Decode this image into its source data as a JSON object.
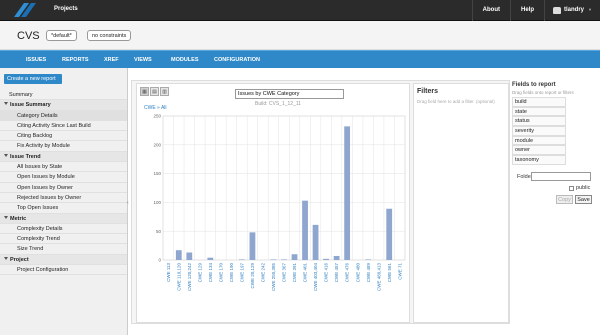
{
  "topbar": {
    "projects_label": "Projects",
    "about_label": "About",
    "help_label": "Help",
    "user_label": "tlandry"
  },
  "project": {
    "name": "CVS",
    "stream_pill": "*default*",
    "constraints_pill": "no constraints"
  },
  "nav": [
    "ISSUES",
    "REPORTS",
    "XREF",
    "VIEWS",
    "MODULES",
    "CONFIGURATION"
  ],
  "sidebar": {
    "create_label": "Create a new report",
    "items": [
      {
        "label": "Summary",
        "kind": "leaf"
      },
      {
        "label": "Issue Summary",
        "kind": "group"
      },
      {
        "label": "Category Details",
        "kind": "child",
        "active": true
      },
      {
        "label": "Citing Activity Since Last Build",
        "kind": "child"
      },
      {
        "label": "Citing Backlog",
        "kind": "child"
      },
      {
        "label": "Fix Activity by Module",
        "kind": "child"
      },
      {
        "label": "Issue Trend",
        "kind": "group"
      },
      {
        "label": "All Issues by State",
        "kind": "child"
      },
      {
        "label": "Open Issues by Module",
        "kind": "child"
      },
      {
        "label": "Open Issues by Owner",
        "kind": "child"
      },
      {
        "label": "Rejected Issues by Owner",
        "kind": "child"
      },
      {
        "label": "Top Open Issues",
        "kind": "child"
      },
      {
        "label": "Metric",
        "kind": "group"
      },
      {
        "label": "Complexity Details",
        "kind": "child"
      },
      {
        "label": "Complexity Trend",
        "kind": "child"
      },
      {
        "label": "Size Trend",
        "kind": "child"
      },
      {
        "label": "Project",
        "kind": "group"
      },
      {
        "label": "Project Configuration",
        "kind": "child"
      }
    ]
  },
  "report": {
    "title_value": "Issues by CWE Category",
    "subtitle": "Build: CVS_1_12_11"
  },
  "chart_data": {
    "type": "bar",
    "title": "Issues by CWE Category",
    "subtitle": "Build: CVS_1_12_11",
    "legend": "CWE » All",
    "ylim": [
      0,
      250
    ],
    "yticks": [
      0,
      50,
      100,
      150,
      200,
      250
    ],
    "grid": true,
    "bar_color": "#8fa6cf",
    "categories": [
      "CWE 113",
      "CWE 119,120",
      "CWE 120,242",
      "CWE 129",
      "CWE 134",
      "CWE 170",
      "CWE 190",
      "CWE 197",
      "CWE 20,129",
      "CWE 242",
      "CWE 250,385",
      "CWE 367",
      "CWE 391",
      "CWE 401",
      "CWE 403,404",
      "CWE 416",
      "CWE 457",
      "CWE 476",
      "CWE 480",
      "CWE 489",
      "CWE 489,413",
      "CWE 561",
      "CWE 71"
    ],
    "values": [
      0,
      17,
      13,
      0,
      4,
      0,
      0,
      1,
      48,
      0,
      1,
      1,
      10,
      103,
      61,
      2,
      7,
      232,
      0,
      1,
      0,
      89,
      0
    ]
  },
  "filters": {
    "title": "Filters",
    "hint": "Drag field here to add a filter. (optional)"
  },
  "fields": {
    "title": "Fields to report",
    "hint": "Drag fields onto report or filters",
    "items": [
      "build",
      "state",
      "status",
      "severity",
      "module",
      "owner",
      "taxonomy"
    ],
    "folder_label": "Folder:",
    "public_label": "public",
    "copy_label": "Copy",
    "save_label": "Save"
  }
}
